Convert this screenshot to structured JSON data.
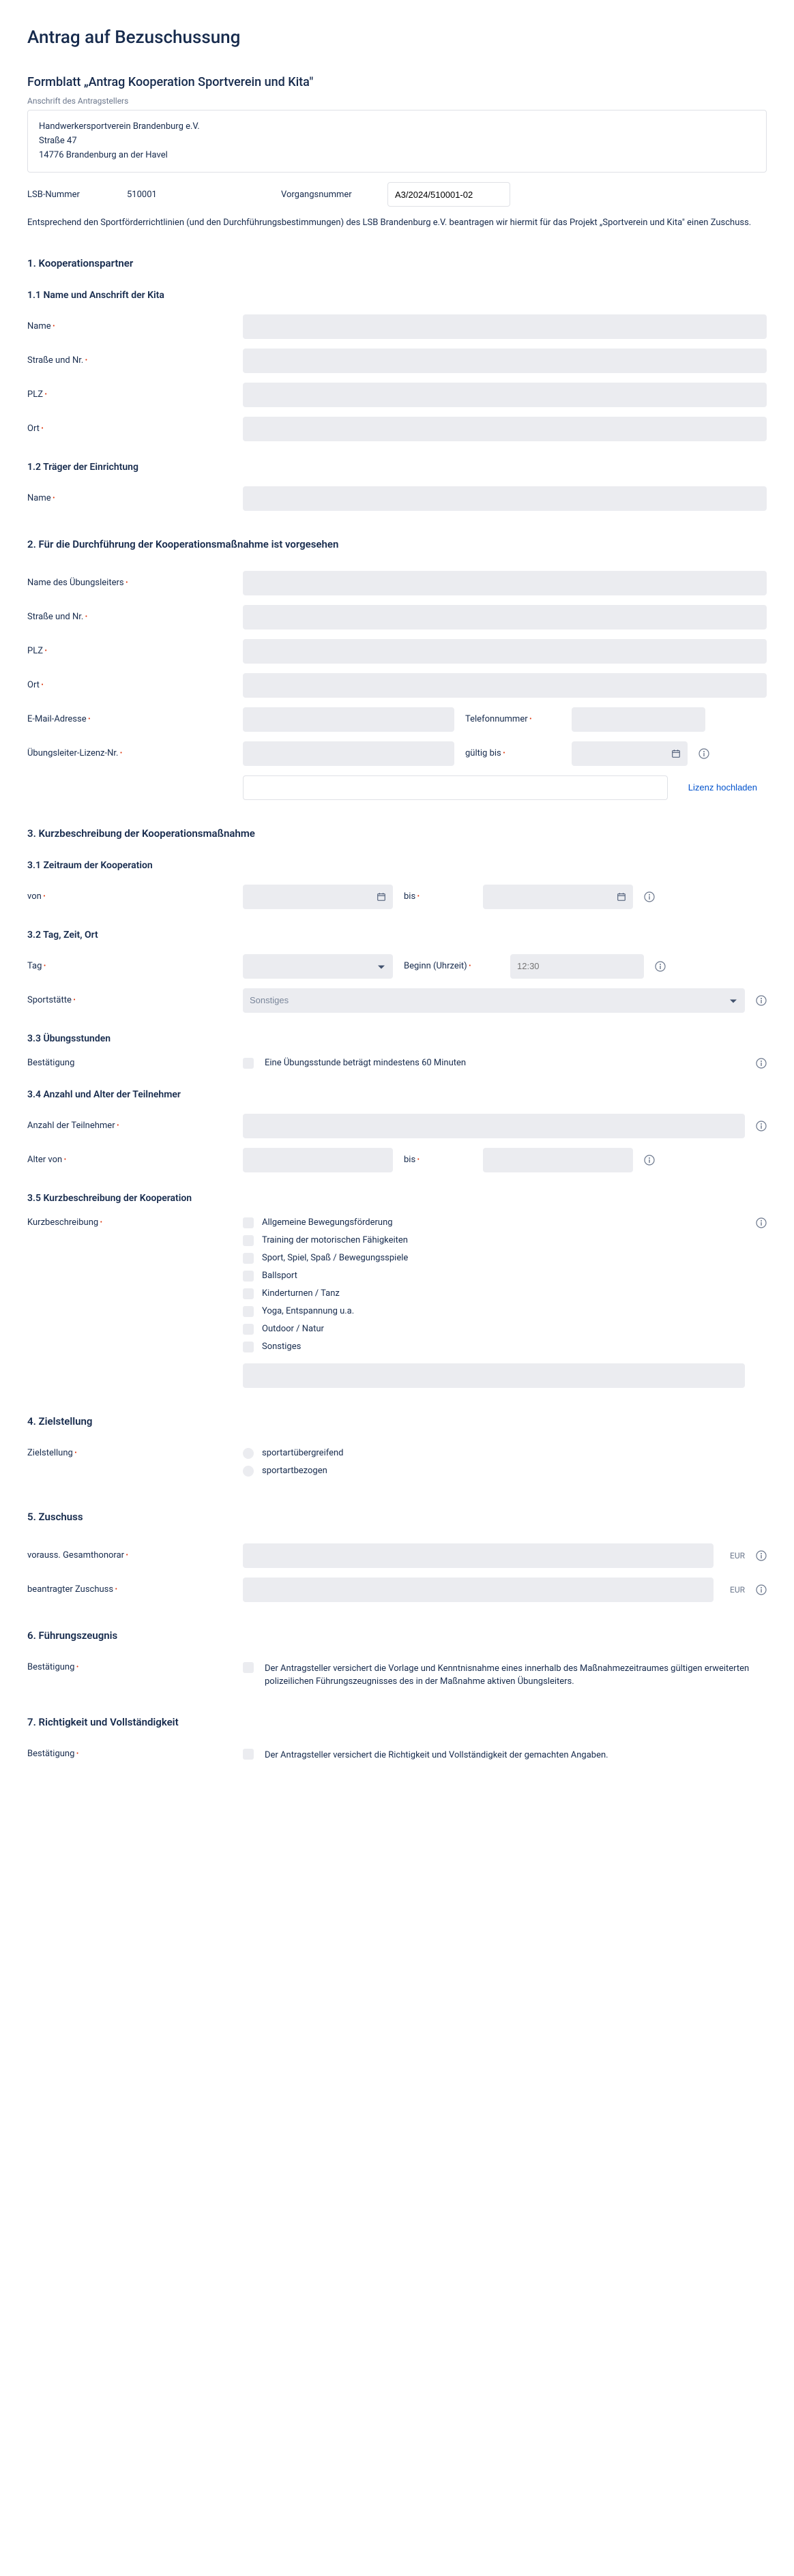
{
  "page_title": "Antrag auf Bezuschussung",
  "form_title": "Formblatt „Antrag Kooperation Sportverein und Kita\"",
  "applicant_label": "Anschrift des Antragstellers",
  "applicant_address": {
    "line1": "Handwerkersportverein Brandenburg e.V.",
    "line2": "Straße 47",
    "line3": "14776 Brandenburg an der Havel"
  },
  "lsb_label": "LSB-Nummer",
  "lsb_value": "510001",
  "vorgang_label": "Vorgangsnummer",
  "vorgang_value": "A3/2024/510001-02",
  "intro_text": "Entsprechend den Sportförderrichtlinien (und den Durchführungsbestimmungen) des LSB Brandenburg e.V. beantragen wir hiermit für das Projekt „Sportverein und Kita\" einen Zuschuss.",
  "s1": {
    "title": "1. Kooperationspartner",
    "sub1": "1.1 Name und Anschrift der Kita",
    "name": "Name",
    "street": "Straße und Nr.",
    "plz": "PLZ",
    "ort": "Ort",
    "sub2": "1.2 Träger der Einrichtung",
    "traeger_name": "Name"
  },
  "s2": {
    "title": "2. Für die Durchführung der Kooperationsmaßnahme ist vorgesehen",
    "leader_name": "Name des Übungsleiters",
    "street": "Straße und Nr.",
    "plz": "PLZ",
    "ort": "Ort",
    "email": "E-Mail-Adresse",
    "phone": "Telefonnummer",
    "license": "Übungsleiter-Lizenz-Nr.",
    "valid": "gültig bis",
    "upload": "Lizenz hochladen"
  },
  "s3": {
    "title": "3. Kurzbeschreibung der Kooperationsmaßnahme",
    "sub1": "3.1 Zeitraum der Kooperation",
    "von": "von",
    "bis": "bis",
    "sub2": "3.2 Tag, Zeit, Ort",
    "tag": "Tag",
    "begin": "Beginn (Uhrzeit)",
    "begin_val": "12:30",
    "sportstaette": "Sportstätte",
    "sportstaette_ph": "Sonstiges",
    "sub3": "3.3 Übungsstunden",
    "best": "Bestätigung",
    "best_text": "Eine Übungsstunde beträgt mindestens 60 Minuten",
    "sub4": "3.4 Anzahl und Alter der Teilnehmer",
    "anzahl": "Anzahl der Teilnehmer",
    "alter_von": "Alter von",
    "alter_bis": "bis",
    "sub5": "3.5 Kurzbeschreibung der Kooperation",
    "kurz": "Kurzbeschreibung",
    "opts": [
      "Allgemeine Bewegungsförderung",
      "Training der motorischen Fähigkeiten",
      "Sport, Spiel, Spaß / Bewegungsspiele",
      "Ballsport",
      "Kinderturnen / Tanz",
      "Yoga, Entspannung u.a.",
      "Outdoor / Natur",
      "Sonstiges"
    ]
  },
  "s4": {
    "title": "4. Zielstellung",
    "label": "Zielstellung",
    "opt1": "sportartübergreifend",
    "opt2": "sportartbezogen"
  },
  "s5": {
    "title": "5. Zuschuss",
    "honorar": "vorauss. Gesamthonorar",
    "zuschuss": "beantragter Zuschuss",
    "eur": "EUR"
  },
  "s6": {
    "title": "6. Führungszeugnis",
    "best": "Bestätigung",
    "text": "Der Antragsteller versichert die Vorlage und Kenntnisnahme eines innerhalb des Maßnahmezeitraumes gültigen erweiterten polizeilichen Führungszeugnisses des in der Maßnahme aktiven Übungsleiters."
  },
  "s7": {
    "title": "7. Richtigkeit und Vollständigkeit",
    "best": "Bestätigung",
    "text": "Der Antragsteller versichert die Richtigkeit und Vollständigkeit der gemachten Angaben."
  }
}
